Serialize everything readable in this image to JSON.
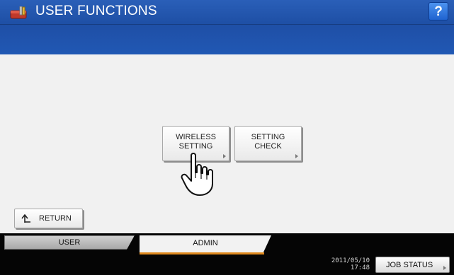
{
  "header": {
    "title": "USER FUNCTIONS",
    "help_label": "?"
  },
  "main": {
    "buttons": [
      {
        "label_line1": "WIRELESS",
        "label_line2": "SETTING"
      },
      {
        "label_line1": "SETTING",
        "label_line2": "CHECK"
      }
    ],
    "return_label": "RETURN"
  },
  "tabs": [
    {
      "label": "USER",
      "active": false
    },
    {
      "label": "ADMIN",
      "active": true
    }
  ],
  "footer": {
    "date": "2011/05/10",
    "time": "17:48",
    "job_status_label": "JOB STATUS"
  },
  "colors": {
    "title_bar": "#1e4fa5",
    "help_button": "#2f74de",
    "active_tab_underline": "#e08a1e"
  },
  "icons": {
    "title": "toolbox-icon",
    "hand": "pointing-hand-icon",
    "return": "return-arrow-icon"
  }
}
